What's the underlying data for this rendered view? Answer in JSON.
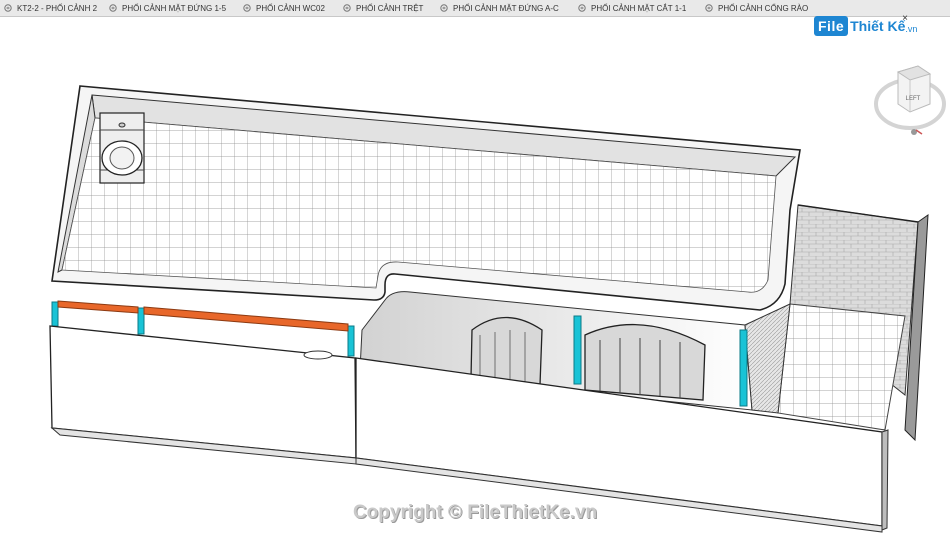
{
  "tabs": [
    {
      "label": "KT2-2 - PHỐI CẢNH 2",
      "icon": "3d-view-icon"
    },
    {
      "label": "PHỐI CẢNH MẶT ĐỨNG 1-5",
      "icon": "3d-view-icon"
    },
    {
      "label": "PHỐI CẢNH WC02",
      "icon": "3d-view-icon"
    },
    {
      "label": "PHỐI CẢNH TRỆT",
      "icon": "3d-view-icon"
    },
    {
      "label": "PHỐI CẢNH MẶT ĐỨNG A-C",
      "icon": "3d-view-icon"
    },
    {
      "label": "PHỐI CẢNH MẶT CẮT 1-1",
      "icon": "3d-view-icon"
    },
    {
      "label": "PHỐI CẢNH CỔNG RÀO",
      "icon": "3d-view-icon"
    }
  ],
  "brand": {
    "file": "File",
    "rest": "Thiết Kế",
    "tld": ".vn"
  },
  "close_symbol": "×",
  "viewcube": {
    "face_label": "LEFT"
  },
  "watermark": "Copyright © FileThietKe.vn",
  "colors": {
    "accent_cyan": "#19c3d6",
    "accent_orange": "#e8672a",
    "brand_blue": "#1e86d2"
  }
}
